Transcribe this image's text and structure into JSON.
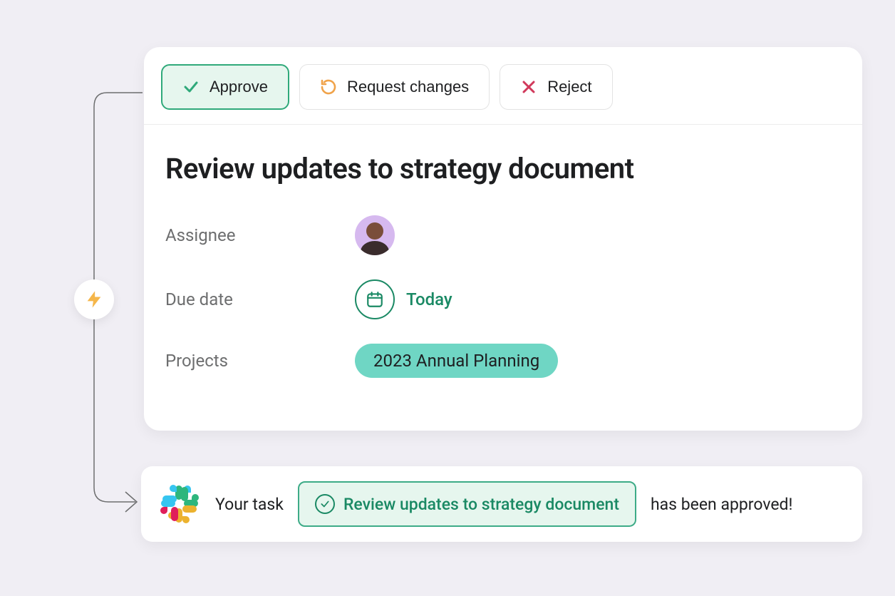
{
  "toolbar": {
    "approve_label": "Approve",
    "request_label": "Request changes",
    "reject_label": "Reject"
  },
  "task": {
    "title": "Review updates to strategy document",
    "fields": {
      "assignee_label": "Assignee",
      "due_label": "Due date",
      "due_value": "Today",
      "projects_label": "Projects",
      "project_chip": "2023 Annual Planning"
    }
  },
  "notification": {
    "prefix": "Your task",
    "task_ref": "Review updates to strategy document",
    "suffix": "has been approved!"
  }
}
